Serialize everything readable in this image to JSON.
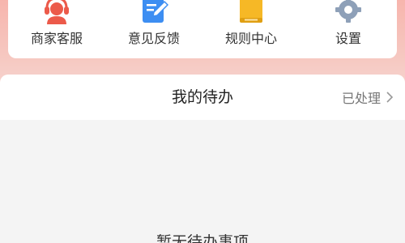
{
  "shortcuts": {
    "items": [
      {
        "label": "商家客服",
        "icon": "customer-service-icon",
        "color": "#ec5a4a"
      },
      {
        "label": "意见反馈",
        "icon": "feedback-edit-icon",
        "color": "#3d8ef2"
      },
      {
        "label": "规则中心",
        "icon": "rules-book-icon",
        "color": "#f6b826"
      },
      {
        "label": "设置",
        "icon": "settings-gear-icon",
        "color": "#8ea0b8"
      }
    ]
  },
  "todo": {
    "title": "我的待办",
    "processed_link": "已处理",
    "empty_text": "暂无待办事项"
  },
  "colors": {
    "header_gradient_top": "#f7b5ad",
    "header_gradient_bottom": "#f7dcd8",
    "page_background": "#f4f4f4",
    "card_background": "#ffffff"
  }
}
